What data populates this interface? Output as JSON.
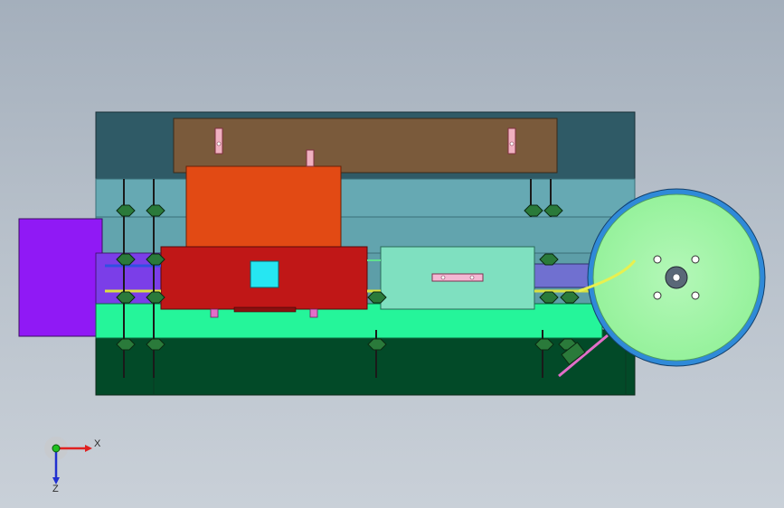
{
  "viewport": {
    "background_top": "#a4afbc",
    "background_bottom": "#c9d0d8"
  },
  "model": {
    "colors": {
      "base_plate": "#024a28",
      "upper_plate": "#2f5a66",
      "brown_plate": "#7a5a3b",
      "guide_blue": "#66a9b3",
      "orange_block": "#e24a14",
      "red_block": "#c01717",
      "cyan_window": "#26e6f2",
      "mint_block": "#7fe0c0",
      "green_strip": "#25f59a",
      "purple_feed": "#9019f5",
      "violet_channel": "#7070d0",
      "reel_face": "#9cf5a0",
      "reel_rim": "#2f8ad8",
      "yellow_wire": "#e8f050",
      "pink_pin": "#e26ec8"
    }
  },
  "triad": {
    "x_label": "X",
    "z_label": "Z",
    "x_color": "#e02020",
    "y_color": "#20c020",
    "z_color": "#2030d0"
  }
}
